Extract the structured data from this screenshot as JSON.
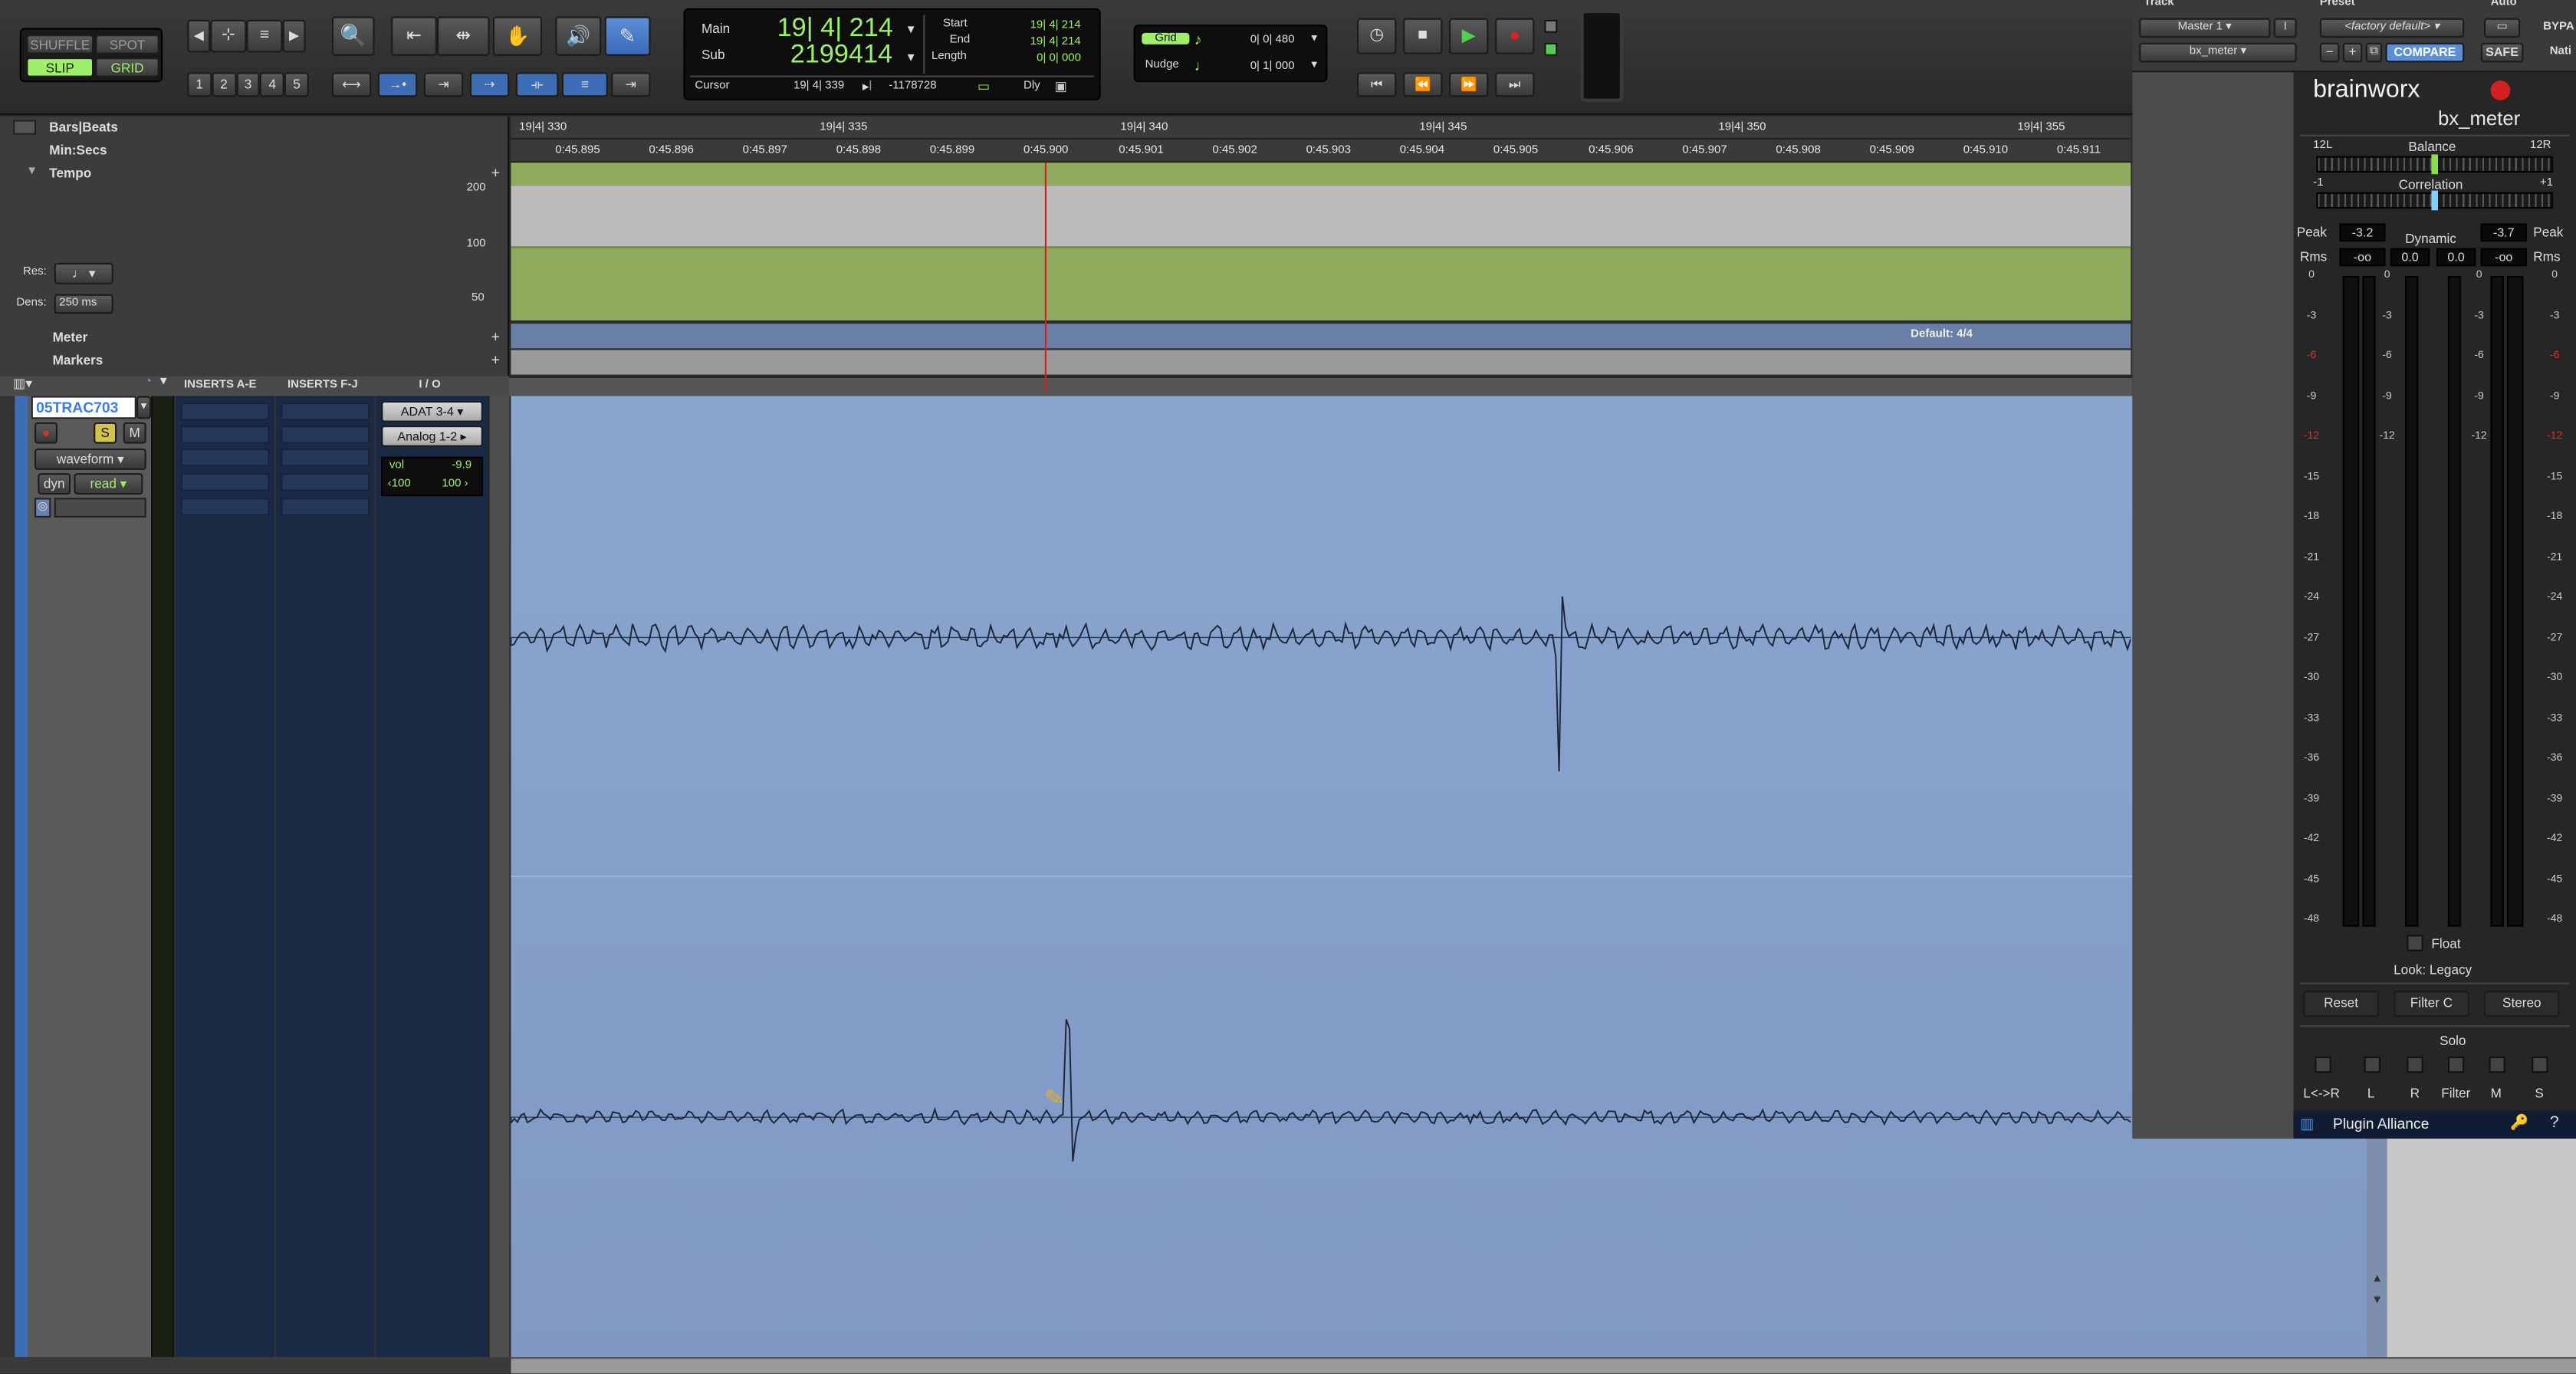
{
  "toolbar": {
    "edit_modes": {
      "shuffle": "SHUFFLE",
      "spot": "SPOT",
      "slip": "SLIP",
      "grid": "GRID"
    },
    "zoom_presets": [
      "1",
      "2",
      "3",
      "4",
      "5"
    ]
  },
  "counter": {
    "main_label": "Main",
    "main_value": "19| 4| 214",
    "sub_label": "Sub",
    "sub_value": "2199414",
    "start_label": "Start",
    "start_value": "19| 4| 214",
    "end_label": "End",
    "end_value": "19| 4| 214",
    "length_label": "Length",
    "length_value": "0| 0| 000",
    "cursor_label": "Cursor",
    "cursor_value": "19| 4| 339",
    "cursor_sample": "-1178728",
    "dly_label": "Dly"
  },
  "grid": {
    "grid_label": "Grid",
    "grid_value": "0| 0| 480",
    "nudge_label": "Nudge",
    "nudge_value": "0| 1| 000"
  },
  "rulers": {
    "bars_beats": "Bars|Beats",
    "min_secs": "Min:Secs",
    "tempo": "Tempo",
    "meter": "Meter",
    "markers": "Markers",
    "res_label": "Res:",
    "dens_label": "Dens:",
    "dens_value": "250 ms",
    "tempo_ticks": [
      "200",
      "100",
      "50"
    ],
    "bar_labels": [
      "19|4| 330",
      "19|4| 335",
      "19|4| 340",
      "19|4| 345",
      "19|4| 350",
      "19|4| 355"
    ],
    "time_labels": [
      "0:45.895",
      "0:45.896",
      "0:45.897",
      "0:45.898",
      "0:45.899",
      "0:45.900",
      "0:45.901",
      "0:45.902",
      "0:45.903",
      "0:45.904",
      "0:45.905",
      "0:45.906",
      "0:45.907",
      "0:45.908",
      "0:45.909",
      "0:45.910",
      "0:45.911"
    ],
    "meter_default": "Default: 4/4"
  },
  "track": {
    "name": "05TRAC703",
    "solo": "S",
    "mute": "M",
    "view": "waveform",
    "automation_mode": "dyn",
    "automation_state": "read",
    "inserts_ae": "INSERTS A-E",
    "inserts_fj": "INSERTS F-J",
    "io": "I / O",
    "input": "ADAT 3-4",
    "output": "Analog 1-2",
    "vol_label": "vol",
    "vol_value": "-9.9",
    "pan_left": "‹100",
    "pan_right": "100 ›"
  },
  "plugin_header": {
    "track_label": "Track",
    "preset_label": "Preset",
    "auto_label": "Auto",
    "track_name": "Master 1",
    "track_letter": "I",
    "plugin_name": "bx_meter",
    "preset_name": "<factory default>",
    "compare": "COMPARE",
    "safe": "SAFE",
    "bypass": "BYPA",
    "native": "Nati"
  },
  "bx_meter": {
    "brand": "brainworx",
    "product": "bx_meter",
    "balance_label": "Balance",
    "balance_left": "12L",
    "balance_right": "12R",
    "correlation_label": "Correlation",
    "corr_left": "-1",
    "corr_right": "+1",
    "peak_label": "Peak",
    "peak_left": "-3.2",
    "peak_right": "-3.7",
    "dynamic_label": "Dynamic",
    "rms_label": "Rms",
    "rms_left": "-oo",
    "dyn_left": "0.0",
    "dyn_right": "0.0",
    "rms_right": "-oo",
    "scale": [
      "0",
      "-3",
      "-6",
      "-9",
      "-12",
      "-15",
      "-18",
      "-21",
      "-24",
      "-27",
      "-30",
      "-33",
      "-36",
      "-39",
      "-42",
      "-45",
      "-48"
    ],
    "mid_scale": [
      "0",
      "-3",
      "-6",
      "-9",
      "-12"
    ],
    "float_label": "Float",
    "look_label": "Look: Legacy",
    "reset": "Reset",
    "filter": "Filter C",
    "stereo": "Stereo",
    "solo_label": "Solo",
    "solo_buttons": [
      "L<->R",
      "L",
      "R",
      "Filter",
      "M",
      "S"
    ],
    "footer": "Plugin Alliance",
    "help": "?"
  },
  "colors": {
    "accent_green": "#9ef06a",
    "track_name": "#3b7de8",
    "waveform_bg": "#8aa6cf",
    "tempo_green": "#8fac5e",
    "playhead": "#d02020"
  }
}
